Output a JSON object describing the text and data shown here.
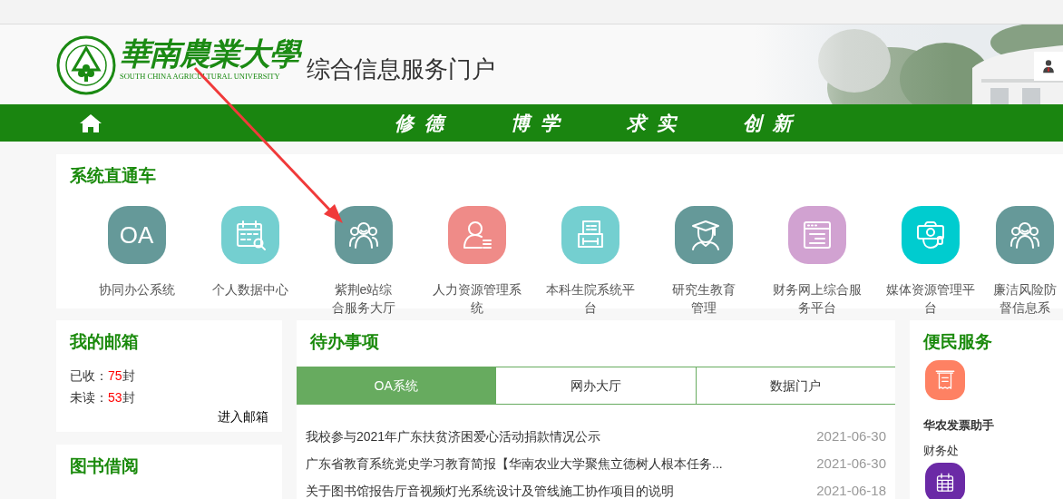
{
  "header": {
    "logo_chinese": "華南農業大學",
    "logo_english": "SOUTH CHINA AGRICULTURAL UNIVERSITY",
    "portal_title": "综合信息服务门户"
  },
  "motto": [
    "修德",
    "博学",
    "求实",
    "创新"
  ],
  "systems": {
    "title": "系统直通车",
    "items": [
      {
        "glyph": "OA",
        "color": "#659999",
        "lines": [
          "协同办公系统"
        ]
      },
      {
        "color": "#74cfd0",
        "lines": [
          "个人数据中心"
        ]
      },
      {
        "color": "#669999",
        "lines": [
          "紫荆e站综",
          "合服务大厅"
        ]
      },
      {
        "color": "#ef8b88",
        "lines": [
          "人力资源管理系",
          "统"
        ]
      },
      {
        "color": "#74cfd0",
        "lines": [
          "本科生院系统平",
          "台"
        ]
      },
      {
        "color": "#659999",
        "lines": [
          "研究生教育",
          "管理"
        ]
      },
      {
        "color": "#d1a2d1",
        "lines": [
          "财务网上综合服",
          "务平台"
        ]
      },
      {
        "color": "#00cccf",
        "lines": [
          "媒体资源管理平",
          "台"
        ]
      },
      {
        "color": "#669999",
        "lines": [
          "廉洁风险防",
          "督信息系"
        ]
      }
    ]
  },
  "mailbox": {
    "title": "我的邮箱",
    "stats": [
      {
        "label": "已收：",
        "count": "75",
        "unit": "封"
      },
      {
        "label": "未读：",
        "count": "53",
        "unit": "封"
      }
    ],
    "link": "进入邮箱"
  },
  "library": {
    "title": "图书借阅"
  },
  "todo": {
    "title": "待办事项",
    "tabs": [
      {
        "label": "OA系统",
        "selected": true
      },
      {
        "label": "网办大厅",
        "selected": false
      },
      {
        "label": "数据门户",
        "selected": false
      }
    ],
    "items": [
      {
        "title": "我校参与2021年广东扶贫济困爱心活动捐款情况公示",
        "date": "2021-06-30"
      },
      {
        "title": "广东省教育系统党史学习教育简报【华南农业大学聚焦立德树人根本任务...",
        "date": "2021-06-30"
      },
      {
        "title": "关于图书馆报告厅音视频灯光系统设计及管线施工协作项目的说明",
        "date": "2021-06-18"
      }
    ]
  },
  "services": {
    "title": "便民服务",
    "items": [
      {
        "color": "#fe8163",
        "title": "华农发票助手",
        "subtitle": "财务处"
      },
      {
        "color": "#6b2aa6"
      }
    ]
  }
}
